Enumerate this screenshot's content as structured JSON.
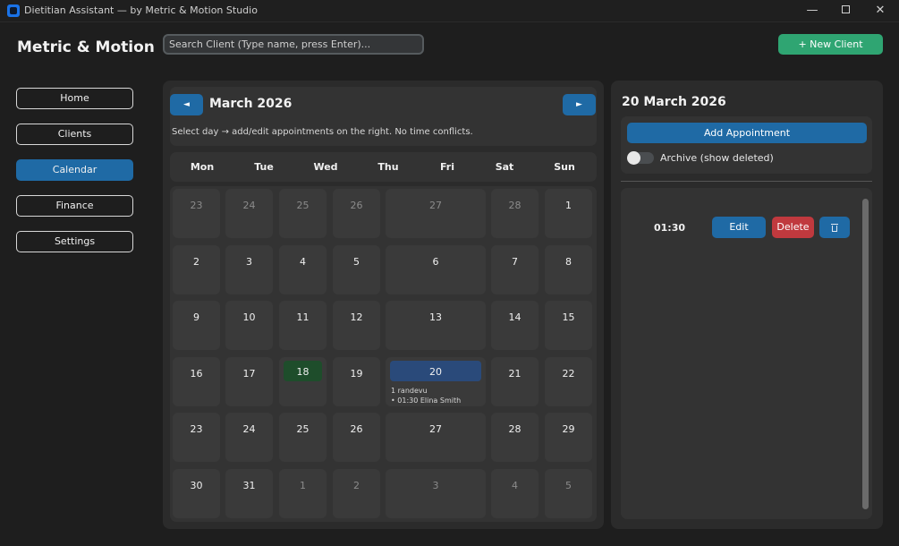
{
  "window": {
    "title": "Dietitian Assistant — by Metric & Motion Studio",
    "min_glyph": "—",
    "close_glyph": "✕"
  },
  "header": {
    "brand": "Metric & Motion",
    "search_placeholder": "Search Client (Type name, press Enter)...",
    "new_client_label": "+ New Client"
  },
  "sidebar": {
    "items": [
      {
        "label": "Home"
      },
      {
        "label": "Clients"
      },
      {
        "label": "Calendar",
        "active": true
      },
      {
        "label": "Finance"
      },
      {
        "label": "Settings"
      }
    ]
  },
  "calendar": {
    "month_title": "March 2026",
    "prev_glyph": "◄",
    "next_glyph": "►",
    "hint": "Select day → add/edit appointments on the right. No time conflicts.",
    "weekdays": [
      "Mon",
      "Tue",
      "Wed",
      "Thu",
      "Fri",
      "Sat",
      "Sun"
    ],
    "weeks": [
      [
        {
          "d": "23",
          "other": true
        },
        {
          "d": "24",
          "other": true
        },
        {
          "d": "25",
          "other": true
        },
        {
          "d": "26",
          "other": true
        },
        {
          "d": "27",
          "other": true
        },
        {
          "d": "28",
          "other": true
        },
        {
          "d": "1"
        }
      ],
      [
        {
          "d": "2"
        },
        {
          "d": "3"
        },
        {
          "d": "4"
        },
        {
          "d": "5"
        },
        {
          "d": "6"
        },
        {
          "d": "7"
        },
        {
          "d": "8"
        }
      ],
      [
        {
          "d": "9"
        },
        {
          "d": "10"
        },
        {
          "d": "11"
        },
        {
          "d": "12"
        },
        {
          "d": "13"
        },
        {
          "d": "14"
        },
        {
          "d": "15"
        }
      ],
      [
        {
          "d": "16"
        },
        {
          "d": "17"
        },
        {
          "d": "18",
          "today": true
        },
        {
          "d": "19"
        },
        {
          "d": "20",
          "selected": true,
          "count": "1 randevu",
          "items": [
            "• 01:30 Elina Smith"
          ]
        },
        {
          "d": "21"
        },
        {
          "d": "22"
        }
      ],
      [
        {
          "d": "23"
        },
        {
          "d": "24"
        },
        {
          "d": "25"
        },
        {
          "d": "26"
        },
        {
          "d": "27"
        },
        {
          "d": "28"
        },
        {
          "d": "29"
        }
      ],
      [
        {
          "d": "30"
        },
        {
          "d": "31"
        },
        {
          "d": "1",
          "other": true
        },
        {
          "d": "2",
          "other": true
        },
        {
          "d": "3",
          "other": true
        },
        {
          "d": "4",
          "other": true
        },
        {
          "d": "5",
          "other": true
        }
      ]
    ]
  },
  "day_panel": {
    "date_title": "20 March 2026",
    "add_label": "Add Appointment",
    "archive_label": "Archive (show deleted)",
    "archive_on": false,
    "appointments": [
      {
        "time": "01:30",
        "edit_label": "Edit",
        "delete_label": "Delete"
      }
    ]
  },
  "colors": {
    "accent": "#1f6aa5",
    "success": "#2fa572",
    "danger": "#c0393e",
    "today_bg": "#1e4d2b",
    "selected_bg": "#2a4a7a"
  }
}
